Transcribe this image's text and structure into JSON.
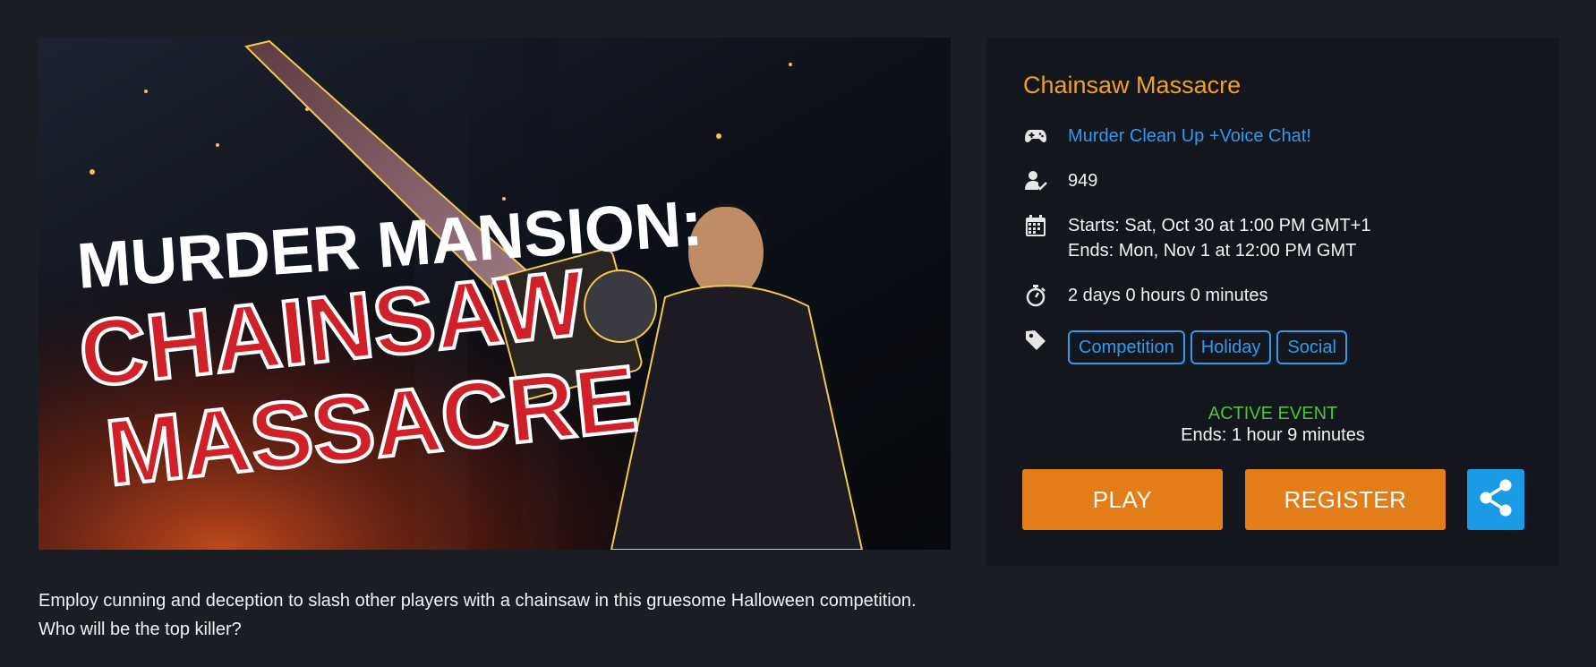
{
  "banner": {
    "title_line1": "MURDER MANSION:",
    "title_line2": "CHAINSAW",
    "title_line3": "MASSACRE"
  },
  "description": {
    "line1": "Employ cunning and deception to slash other players with a chainsaw in this gruesome Halloween competition.",
    "line2": "Who will be the top killer?"
  },
  "event": {
    "title": "Chainsaw Massacre",
    "game_link": "Murder Clean Up +Voice Chat!",
    "registered_count": "949",
    "starts": "Starts: Sat, Oct 30 at 1:00 PM GMT+1",
    "ends": "Ends: Mon, Nov 1 at 12:00 PM GMT",
    "duration": "2 days 0 hours 0 minutes",
    "tags": [
      "Competition",
      "Holiday",
      "Social"
    ],
    "status_label": "ACTIVE EVENT",
    "status_ends": "Ends: 1 hour 9 minutes",
    "play_label": "PLAY",
    "register_label": "REGISTER"
  },
  "icons": {
    "game": "gamepad-icon",
    "players": "user-check-icon",
    "calendar": "calendar-icon",
    "timer": "stopwatch-icon",
    "tags": "tag-icon",
    "share": "share-icon"
  },
  "colors": {
    "background": "#1a1d24",
    "panel": "#13161c",
    "title": "#f0a027",
    "link": "#2d9cf0",
    "active": "#4cc438",
    "button": "#e27d18",
    "share": "#1b9ae6"
  }
}
